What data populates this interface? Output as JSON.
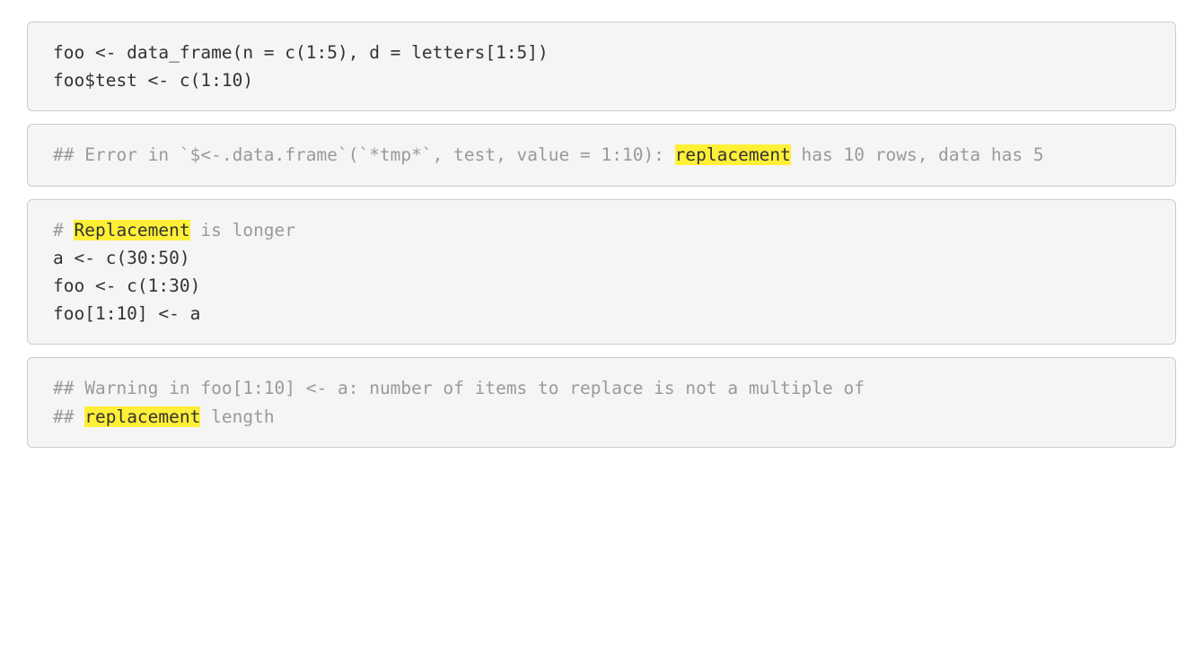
{
  "blocks": {
    "b1": {
      "line1": "foo <- data_frame(n = c(1:5), d = letters[1:5])",
      "line2": "foo$test <- c(1:10)"
    },
    "b2": {
      "pre": "## Error in `$<-.data.frame`(`*tmp*`, test, value = 1:10): ",
      "hl": "replacement",
      "post": " has 10 rows, data has 5"
    },
    "b3": {
      "hash": "# ",
      "hl": "Replacement",
      "rest": " is longer",
      "line2": "a <- c(30:50)",
      "line3": "foo <- c(1:30)",
      "line4": "foo[1:10] <- a"
    },
    "b4": {
      "line1": "## Warning in foo[1:10] <- a: number of items to replace is not a multiple of",
      "line2_pre": "## ",
      "line2_hl": "replacement",
      "line2_post": " length"
    }
  }
}
